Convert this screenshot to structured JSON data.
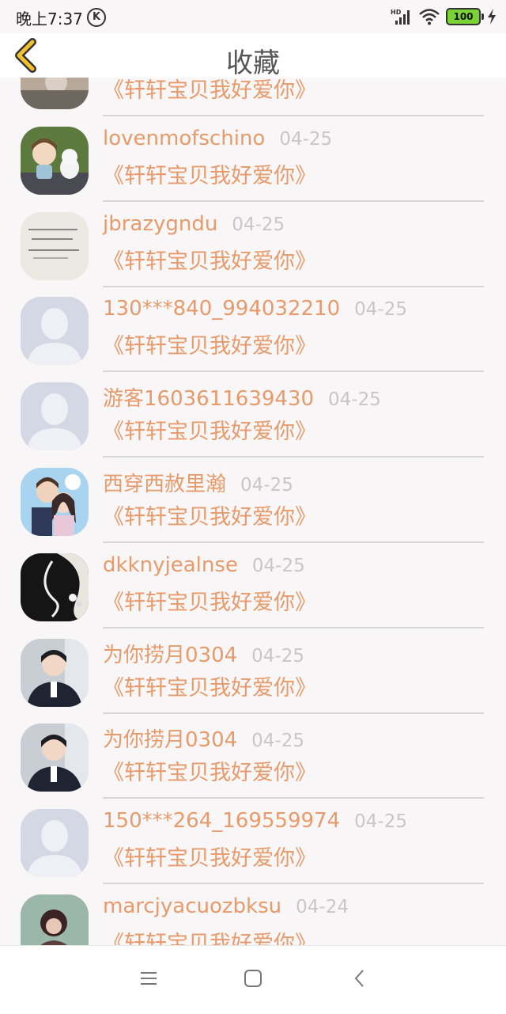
{
  "status_bar": {
    "time": "晚上7:37",
    "k_badge": "K",
    "battery": "100",
    "icons": [
      "hd-signal-icon",
      "wifi-icon",
      "battery-icon",
      "charging-icon"
    ]
  },
  "header": {
    "title": "收藏",
    "back_icon": "chevron-left-icon",
    "accent_color": "#f2c12e"
  },
  "list": {
    "items": [
      {
        "name": "",
        "date": "",
        "song": "《轩轩宝贝我好爱你》",
        "avatar": "photo-flowers"
      },
      {
        "name": "lovenmofschino",
        "date": "04-25",
        "song": "《轩轩宝贝我好爱你》",
        "avatar": "photo-figurines"
      },
      {
        "name": "jbrazygndu",
        "date": "04-25",
        "song": "《轩轩宝贝我好爱你》",
        "avatar": "photo-handwriting"
      },
      {
        "name": "130***840_994032210",
        "date": "04-25",
        "song": "《轩轩宝贝我好爱你》",
        "avatar": "default-user"
      },
      {
        "name": "游客1603611639430",
        "date": "04-25",
        "song": "《轩轩宝贝我好爱你》",
        "avatar": "default-user"
      },
      {
        "name": "西穿西赦里瀚",
        "date": "04-25",
        "song": "《轩轩宝贝我好爱你》",
        "avatar": "photo-anime-couple"
      },
      {
        "name": "dkknyjealnse",
        "date": "04-25",
        "song": "《轩轩宝贝我好爱你》",
        "avatar": "photo-ink-art"
      },
      {
        "name": "为你捞月0304",
        "date": "04-25",
        "song": "《轩轩宝贝我好爱你》",
        "avatar": "photo-boy-suit"
      },
      {
        "name": "为你捞月0304",
        "date": "04-25",
        "song": "《轩轩宝贝我好爱你》",
        "avatar": "photo-boy-suit"
      },
      {
        "name": "150***264_169559974",
        "date": "04-25",
        "song": "《轩轩宝贝我好爱你》",
        "avatar": "default-user"
      },
      {
        "name": "marcjyacuozbksu",
        "date": "04-24",
        "song": "《轩轩宝贝我好爱你》",
        "avatar": "photo-girl"
      }
    ]
  },
  "colors": {
    "name_text": "#e89a6a",
    "date_text": "#c7c7c7",
    "background": "#f8f6f7"
  },
  "nav_bar": {
    "icons": [
      "menu-icon",
      "home-icon",
      "back-icon"
    ]
  }
}
